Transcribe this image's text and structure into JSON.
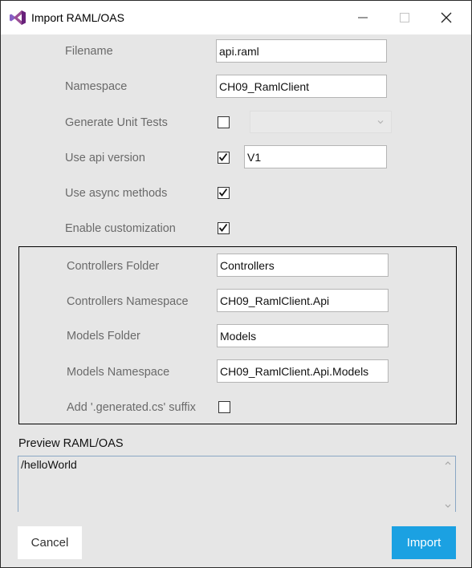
{
  "window": {
    "title": "Import RAML/OAS",
    "icon": "visual-studio-icon",
    "controls": [
      "minimize-icon",
      "maximize-icon",
      "close-icon"
    ]
  },
  "form": {
    "filename": {
      "label": "Filename",
      "value": "api.raml"
    },
    "namespace": {
      "label": "Namespace",
      "value": "CH09_RamlClient"
    },
    "generate_unit_tests": {
      "label": "Generate Unit Tests",
      "checked": false,
      "combo_value": ""
    },
    "use_api_version": {
      "label": "Use api version",
      "checked": true,
      "value": "V1"
    },
    "use_async": {
      "label": "Use async methods",
      "checked": true
    },
    "enable_customization": {
      "label": "Enable customization",
      "checked": true
    }
  },
  "customization": {
    "controllers_folder": {
      "label": "Controllers Folder",
      "value": "Controllers"
    },
    "controllers_namespace": {
      "label": "Controllers Namespace",
      "value": "CH09_RamlClient.Api"
    },
    "models_folder": {
      "label": "Models Folder",
      "value": "Models"
    },
    "models_namespace": {
      "label": "Models Namespace",
      "value": "CH09_RamlClient.Api.Models"
    },
    "generated_suffix": {
      "label": "Add '.generated.cs' suffix",
      "checked": false
    }
  },
  "preview": {
    "label": "Preview RAML/OAS",
    "content": "/helloWorld"
  },
  "buttons": {
    "cancel": "Cancel",
    "import": "Import"
  },
  "colors": {
    "accent": "#1ba1e2",
    "vs_purple": "#68217a"
  }
}
